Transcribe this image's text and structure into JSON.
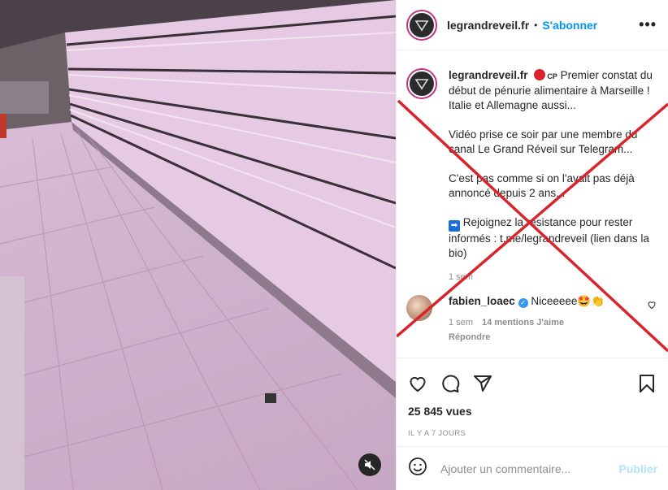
{
  "post": {
    "username": "legrandreveil.fr",
    "separator": "•",
    "follow_label": "S'abonner",
    "more_label": "•••",
    "caption": {
      "username": "legrandreveil.fr",
      "badge": "CP",
      "line1": "Premier constat du début de pénurie alimentaire à Marseille ! Italie et Allemagne aussi...",
      "line2": "Vidéo prise ce soir par une membre du canal Le Grand Réveil sur Telegram...",
      "line3": "C'est pas comme si on l'avait pas déjà annoncé depuis 2 ans...",
      "line4": "Rejoignez la résistance pour rester informés : t.me/legrandreveil (lien dans la bio)",
      "time": "1 sem"
    },
    "comment": {
      "username": "fabien_loaec",
      "text": "Niceeeee🤩👏",
      "time": "1 sem",
      "likes": "14 mentions J'aime",
      "reply": "Répondre"
    },
    "views": "25 845 vues",
    "age": "IL Y A 7 JOURS",
    "add_comment_placeholder": "Ajouter un commentaire...",
    "publish_label": "Publier"
  },
  "icons": {
    "mute": "muted-speaker-icon",
    "like": "heart-icon",
    "comment": "comment-bubble-icon",
    "share": "paper-plane-icon",
    "save": "bookmark-icon",
    "emoji": "emoji-icon"
  },
  "colors": {
    "accent": "#0095f6",
    "cross": "#d9242c",
    "publish_disabled": "#b2dffc"
  }
}
